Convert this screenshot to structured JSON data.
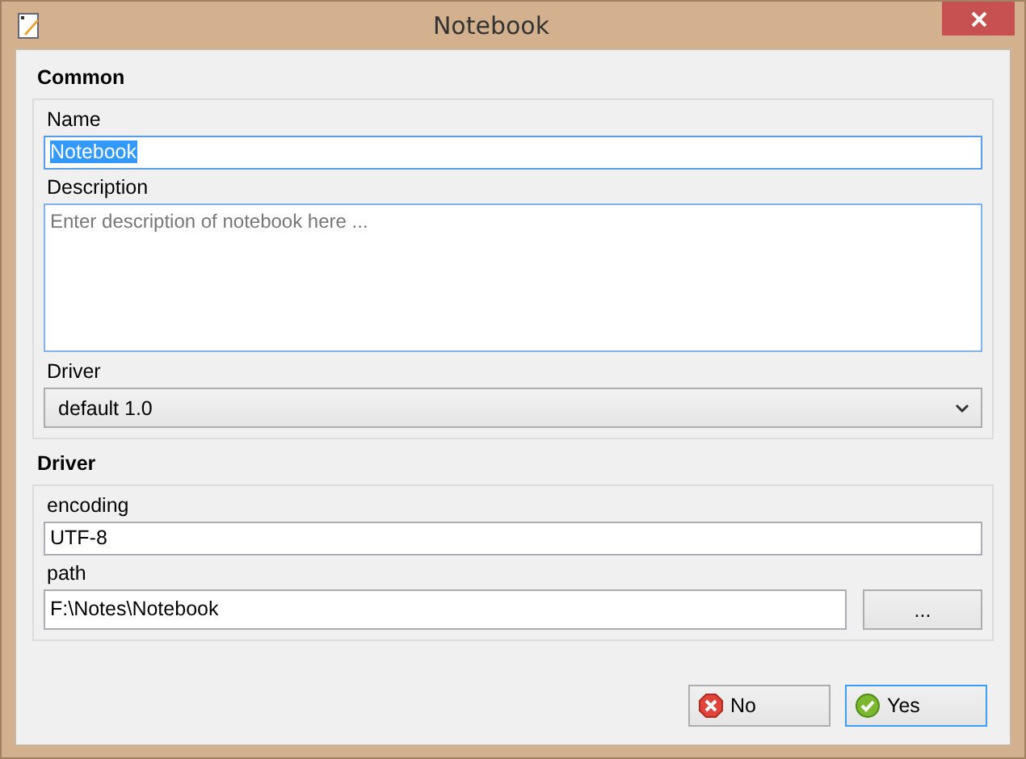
{
  "window": {
    "title": "Notebook"
  },
  "sections": [
    {
      "heading": "Common",
      "fields": [
        {
          "kind": "text",
          "label": "Name",
          "value": "Notebook",
          "focused": true
        },
        {
          "kind": "textarea",
          "label": "Description",
          "placeholder": "Enter description of notebook here ..."
        },
        {
          "kind": "select",
          "label": "Driver",
          "value": "default 1.0"
        }
      ]
    },
    {
      "heading": "Driver",
      "fields": [
        {
          "kind": "text",
          "label": "encoding",
          "value": "UTF-8",
          "focused": false
        },
        {
          "kind": "browse",
          "label": "path",
          "value": "F:\\Notes\\Notebook",
          "button": "..."
        }
      ]
    }
  ],
  "buttons": [
    {
      "label": "No",
      "kind": "no",
      "focused": false
    },
    {
      "label": "Yes",
      "kind": "yes",
      "focused": true
    }
  ]
}
